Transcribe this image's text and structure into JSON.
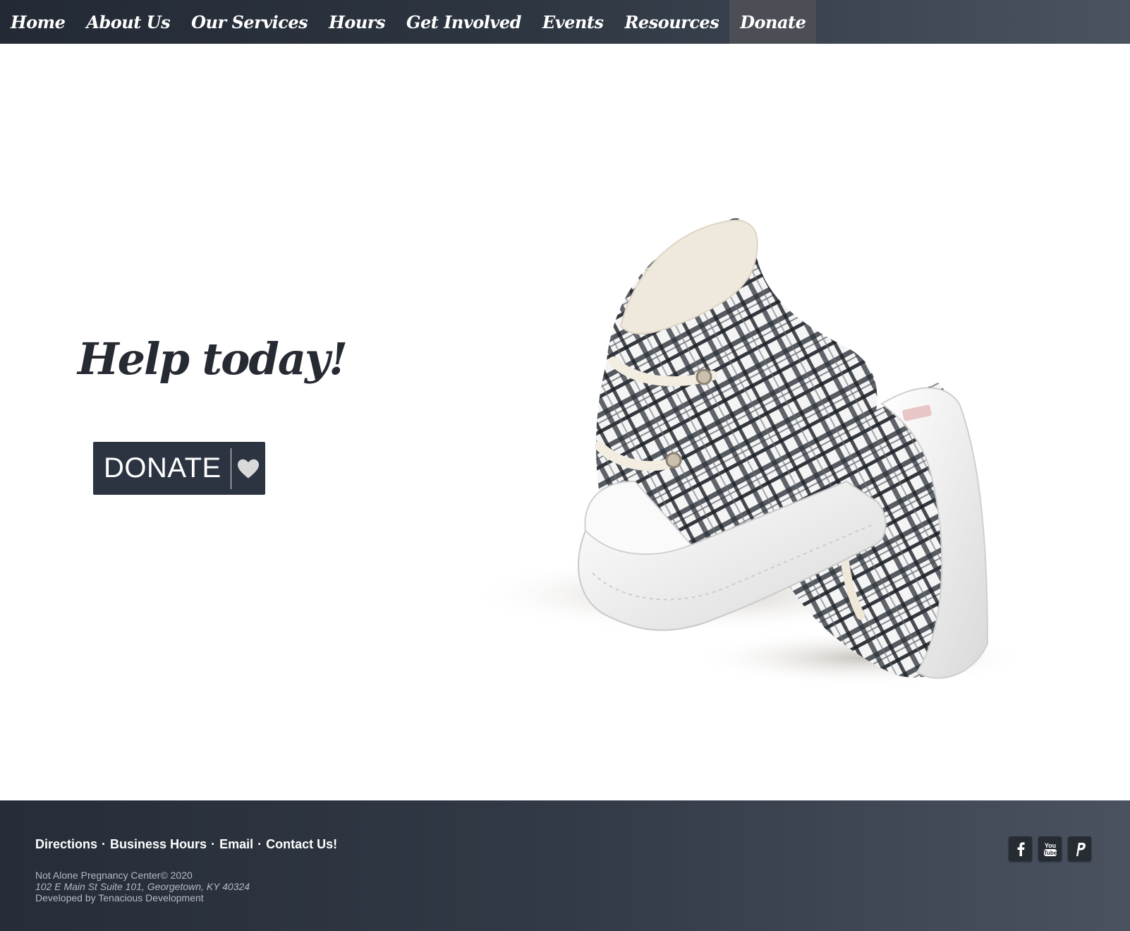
{
  "nav": {
    "items": [
      {
        "label": "Home"
      },
      {
        "label": "About Us"
      },
      {
        "label": "Our Services"
      },
      {
        "label": "Hours"
      },
      {
        "label": "Get Involved"
      },
      {
        "label": "Events"
      },
      {
        "label": "Resources"
      },
      {
        "label": "Donate",
        "active": true
      }
    ]
  },
  "hero": {
    "title": "Help today!",
    "donate_label": "DONATE",
    "donate_icon": "heart-icon",
    "image": "baby-sneakers-photo"
  },
  "footer": {
    "links": [
      "Directions",
      "Business Hours",
      "Email",
      "Contact Us!"
    ],
    "copyright": "Not Alone Pregnancy Center© 2020",
    "address": "102 E Main St Suite 101, Georgetown, KY 40324",
    "developer": "Developed by Tenacious Development",
    "social": [
      "facebook-icon",
      "youtube-icon",
      "paypal-icon"
    ]
  },
  "colors": {
    "nav_bg": "#2d3541",
    "nav_active": "#4b4f55",
    "button_bg": "#2c3441",
    "title_text": "#262b33",
    "footer_bg": "#323a47"
  }
}
